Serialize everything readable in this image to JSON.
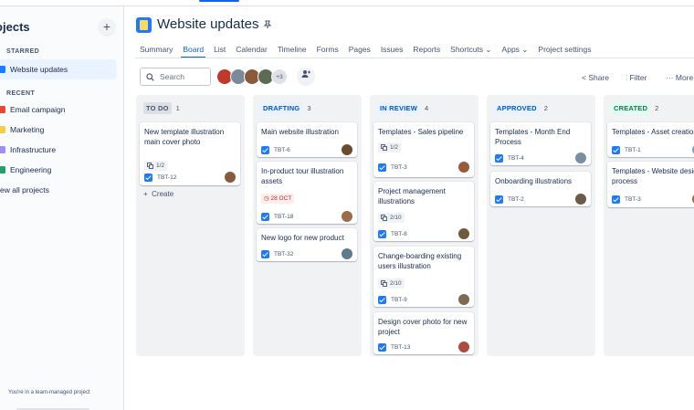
{
  "sidebar": {
    "title": "rojects",
    "add_label": "+",
    "starred_label": "STARRED",
    "recent_label": "RECENT",
    "starred": [
      {
        "label": "Website updates",
        "color": "#1d7afc"
      }
    ],
    "recent": [
      {
        "label": "Email campaign",
        "color": "#e34935"
      },
      {
        "label": "Marketing",
        "color": "#f5cd47"
      },
      {
        "label": "Infrastructure",
        "color": "#9f8fef"
      },
      {
        "label": "Engineering",
        "color": "#22a06b"
      }
    ],
    "view_all": "ew all projects",
    "footer": "You're in a team-managed project"
  },
  "header": {
    "title": "Website updates"
  },
  "tabs": [
    "Summary",
    "Board",
    "List",
    "Calendar",
    "Timeline",
    "Forms",
    "Pages",
    "Issues",
    "Reports",
    "Shortcuts ⌄",
    "Apps ⌄",
    "Project settings"
  ],
  "toolbar": {
    "search_placeholder": "Search",
    "avatar_more": "+3",
    "share": "Share",
    "filter": "Filter",
    "more": "More"
  },
  "columns": [
    {
      "name": "TO DO",
      "count": "1",
      "badge_bg": "#dcdfe4",
      "badge_fg": "#44546f",
      "cards": [
        {
          "title": "New template illustration main cover photo",
          "sub": "1/2",
          "key": "TBT-12",
          "av": "#8a5a3c"
        }
      ],
      "create": "Create"
    },
    {
      "name": "DRAFTING",
      "count": "3",
      "badge_bg": "#e9f2ff",
      "badge_fg": "#0055cc",
      "cards": [
        {
          "title": "Main website illustration",
          "key": "TBT-6",
          "av": "#6b4a2d"
        },
        {
          "title": "In-product tour illustration assets",
          "due": "28 OCT",
          "key": "TBT-18",
          "av": "#9c6b4a"
        },
        {
          "title": "New logo for new product",
          "key": "TBT-32",
          "av": "#5f7a8c"
        }
      ]
    },
    {
      "name": "IN REVIEW",
      "count": "4",
      "badge_bg": "#e9f2ff",
      "badge_fg": "#0055cc",
      "cards": [
        {
          "title": "Templates - Sales pipeline",
          "sub": "1/2",
          "key": "TBT-3",
          "av": "#9a5b3b"
        },
        {
          "title": "Project management illustrations",
          "sub": "2/10",
          "key": "TBT-8",
          "av": "#6e5a3f"
        },
        {
          "title": "Change-boarding existing users illustration",
          "sub": "2/10",
          "key": "TBT-9",
          "av": "#7d6a4f"
        },
        {
          "title": "Design cover photo for new project",
          "key": "TBT-13",
          "av": "#b04a3d"
        }
      ]
    },
    {
      "name": "APPROVED",
      "count": "2",
      "badge_bg": "#e9f2ff",
      "badge_fg": "#0055cc",
      "cards": [
        {
          "title": "Templates - Month End Process",
          "key": "TBT-4",
          "av": "#7b8fa3"
        },
        {
          "title": "Onboarding illustrations",
          "key": "TBT-2",
          "av": "#6b5a44"
        }
      ]
    },
    {
      "name": "CREATED",
      "count": "2",
      "badge_bg": "#dcfff1",
      "badge_fg": "#216e4e",
      "cards": [
        {
          "title": "Templates - Asset creation",
          "key": "TBT-1",
          "av": "#7fa4b8"
        },
        {
          "title": "Templates - Website design process",
          "key": "TBT-3",
          "av": "#a06a40"
        }
      ]
    }
  ]
}
